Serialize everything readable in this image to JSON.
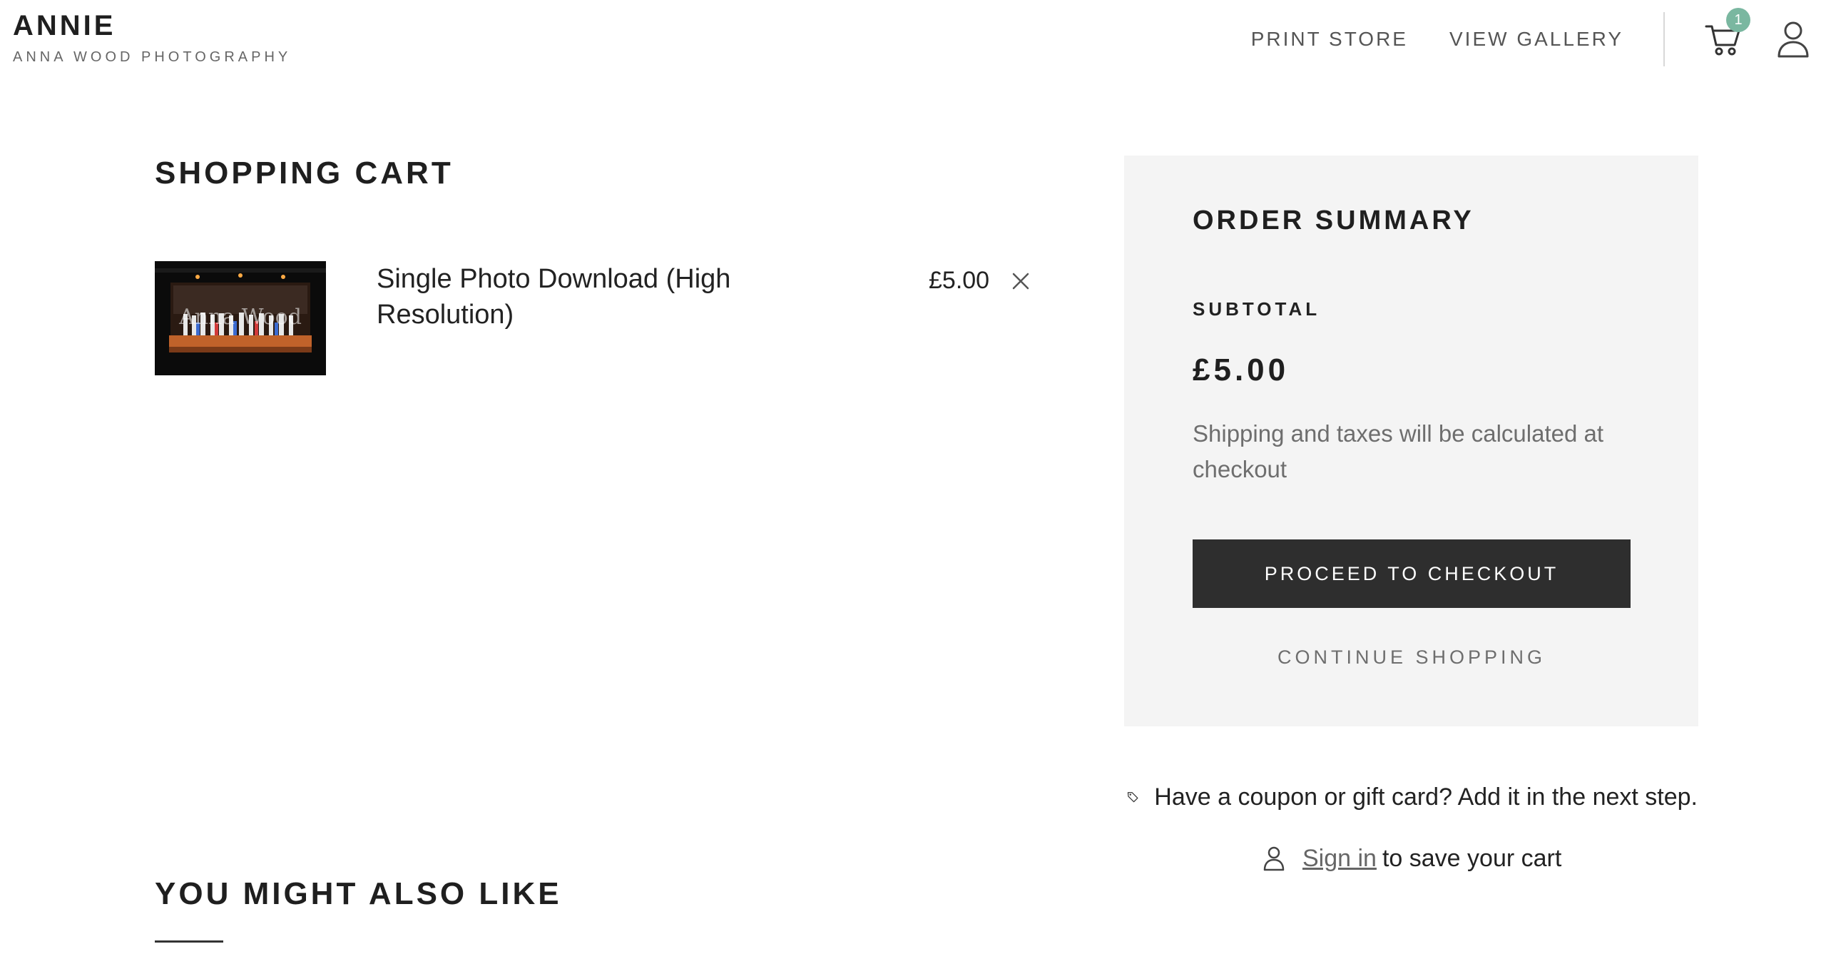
{
  "header": {
    "brand_title": "ANNIE",
    "brand_subtitle": "ANNA WOOD PHOTOGRAPHY",
    "nav": [
      {
        "label": "PRINT STORE"
      },
      {
        "label": "VIEW GALLERY"
      }
    ],
    "cart_count": "1",
    "icons": {
      "cart": "cart-icon",
      "account": "user-icon"
    },
    "badge_color": "#7ab7a0"
  },
  "cart": {
    "title": "SHOPPING CART",
    "items": [
      {
        "name": "Single Photo Download (High Resolution)",
        "price": "£5.00",
        "thumbnail_watermark": "Anna Wood"
      }
    ]
  },
  "summary": {
    "title": "ORDER SUMMARY",
    "subtotal_label": "SUBTOTAL",
    "subtotal_value": "£5.00",
    "shipping_note": "Shipping and taxes will be calculated at checkout",
    "checkout_label": "PROCEED TO CHECKOUT",
    "continue_label": "CONTINUE SHOPPING",
    "checkout_button_color": "#2e2e2e",
    "panel_color": "#f4f4f4"
  },
  "coupon": {
    "text": "Have a coupon or gift card? Add it in the next step.",
    "icon": "tag-icon"
  },
  "signin": {
    "link_label": "Sign in",
    "rest_text": "to save your cart",
    "icon": "user-icon"
  },
  "recommendations": {
    "title": "YOU MIGHT ALSO LIKE"
  }
}
